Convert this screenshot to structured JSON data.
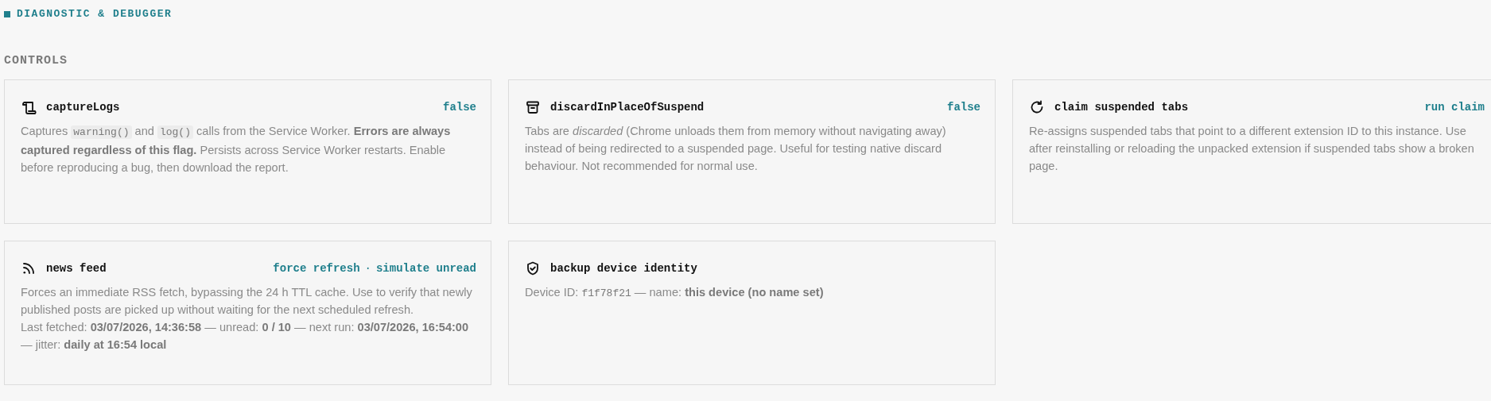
{
  "section_label": "DIAGNOSTIC & DEBUGGER",
  "group_title": "CONTROLS",
  "cards": [
    {
      "title": "captureLogs",
      "actions": [
        {
          "text": "false",
          "kind": "value"
        }
      ],
      "paragraphs": [
        [
          {
            "kind": "text",
            "text": "Captures "
          },
          {
            "kind": "code",
            "text": "warning()"
          },
          {
            "kind": "text",
            "text": " and "
          },
          {
            "kind": "code",
            "text": "log()"
          },
          {
            "kind": "text",
            "text": " calls from the Service Worker. "
          },
          {
            "kind": "bold",
            "text": "Errors are always captured regardless of this flag."
          },
          {
            "kind": "text",
            "text": " Persists across Service Worker restarts. Enable before reproducing a bug, then download the report."
          }
        ]
      ]
    },
    {
      "title": "discardInPlaceOfSuspend",
      "actions": [
        {
          "text": "false",
          "kind": "value"
        }
      ],
      "paragraphs": [
        [
          {
            "kind": "text",
            "text": "Tabs are "
          },
          {
            "kind": "italic",
            "text": "discarded"
          },
          {
            "kind": "text",
            "text": " (Chrome unloads them from memory without navigating away) instead of being redirected to a suspended page. Useful for testing native discard behaviour. Not recommended for normal use."
          }
        ]
      ]
    },
    {
      "title": "claim suspended tabs",
      "actions": [
        {
          "text": "run claim",
          "kind": "link"
        }
      ],
      "paragraphs": [
        [
          {
            "kind": "text",
            "text": "Re-assigns suspended tabs that point to a different extension ID to this instance. Use after reinstalling or reloading the unpacked extension if suspended tabs show a broken page."
          }
        ]
      ]
    },
    {
      "title": "news feed",
      "actions": [
        {
          "text": "force refresh",
          "kind": "link"
        },
        {
          "text": "·",
          "kind": "separator"
        },
        {
          "text": "simulate unread",
          "kind": "link"
        }
      ],
      "paragraphs": [
        [
          {
            "kind": "text",
            "text": "Forces an immediate RSS fetch, bypassing the 24 h TTL cache. Use to verify that newly published posts are picked up without waiting for the next scheduled refresh."
          }
        ],
        [
          {
            "kind": "text",
            "text": "Last fetched: "
          },
          {
            "kind": "bold",
            "text": "03/07/2026, 14:36:58"
          },
          {
            "kind": "text",
            "text": " — unread: "
          },
          {
            "kind": "bold",
            "text": "0 / 10"
          },
          {
            "kind": "text",
            "text": " — next run: "
          },
          {
            "kind": "bold",
            "text": "03/07/2026, 16:54:00"
          },
          {
            "kind": "text",
            "text": " — jitter: "
          },
          {
            "kind": "bold",
            "text": "daily at 16:54 local"
          }
        ]
      ]
    },
    {
      "title": "backup device identity",
      "paragraphs": [
        [
          {
            "kind": "text",
            "text": "Device ID: "
          },
          {
            "kind": "mono",
            "text": "f1f78f21"
          },
          {
            "kind": "text",
            "text": " — name: "
          },
          {
            "kind": "bold",
            "text": "this device (no name set)"
          }
        ]
      ]
    }
  ]
}
